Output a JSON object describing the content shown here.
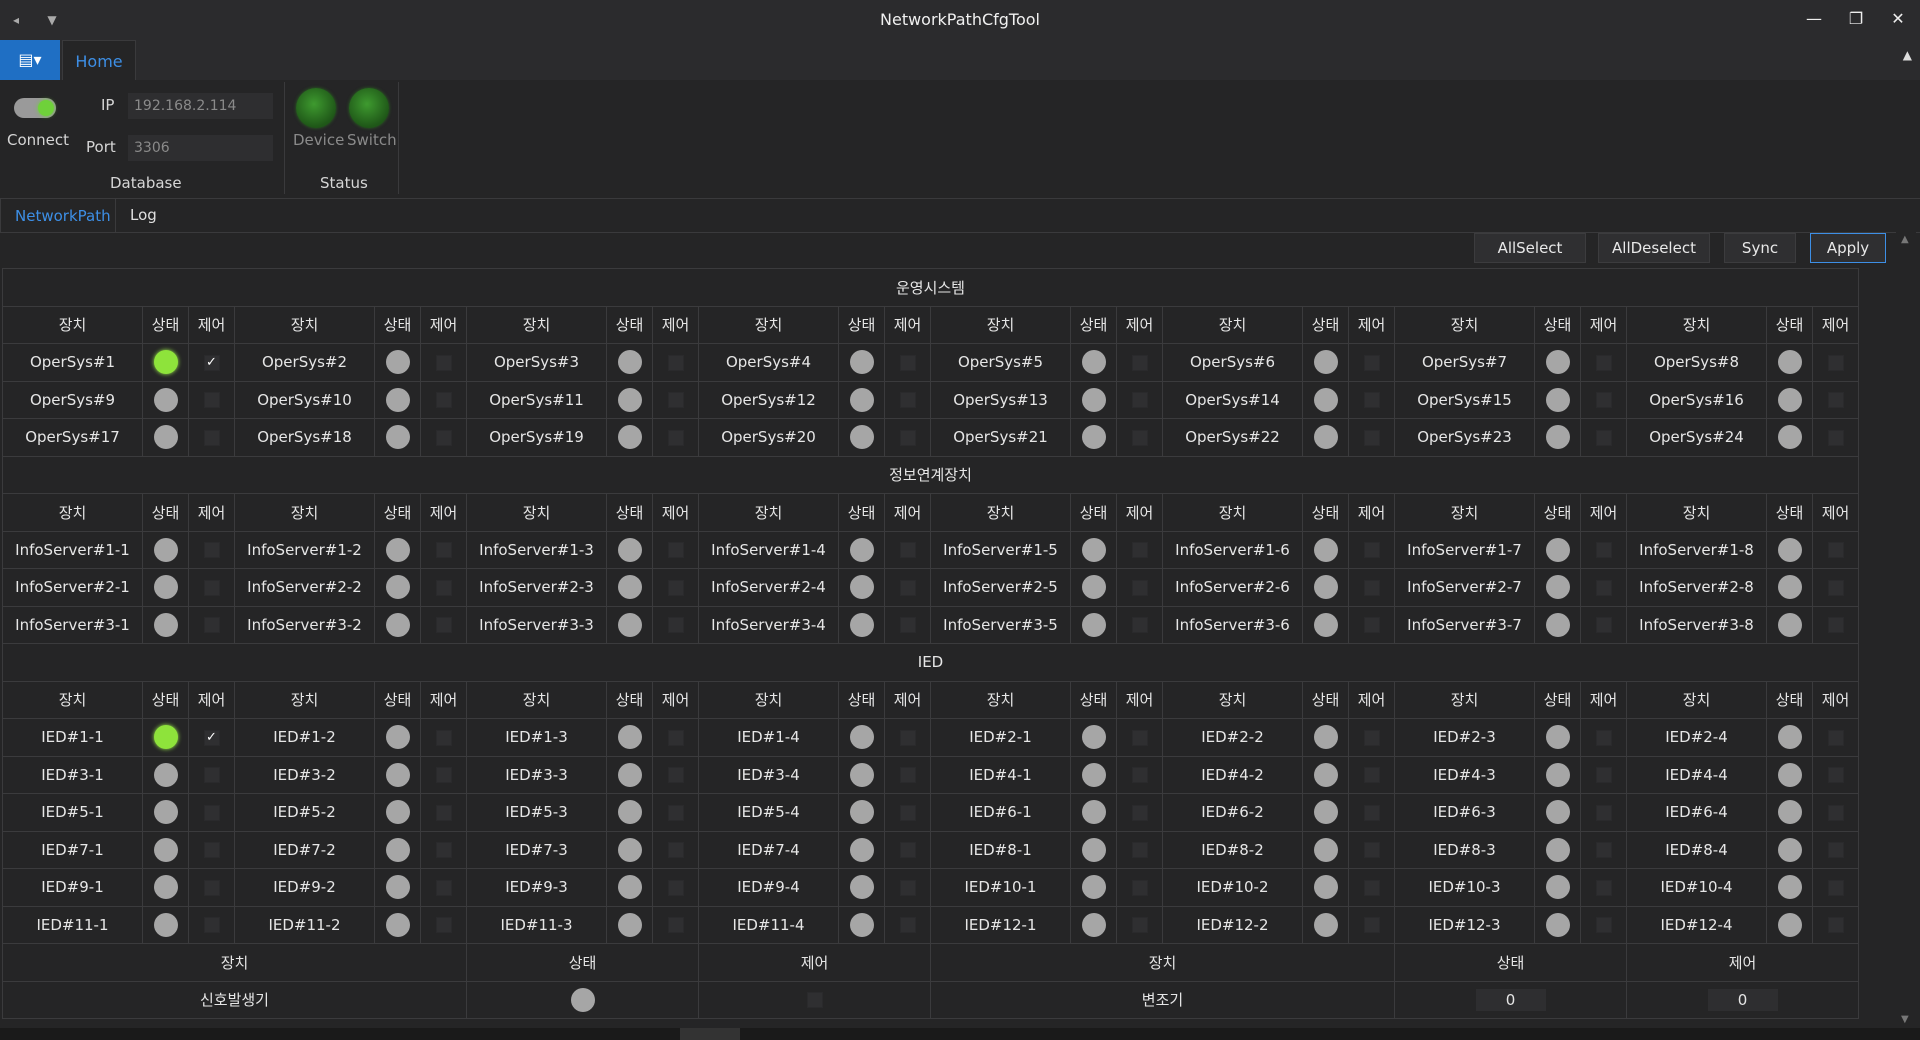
{
  "window": {
    "title": "NetworkPathCfgTool"
  },
  "ribbon": {
    "tab_home": "Home",
    "connect_label": "Connect",
    "ip_label": "IP",
    "ip_value": "192.168.2.114",
    "port_label": "Port",
    "port_value": "3306",
    "group_database": "Database",
    "device_label": "Device",
    "switch_label": "Switch",
    "group_status": "Status"
  },
  "content_tabs": [
    "NetworkPath",
    "Log"
  ],
  "toolbar": {
    "allselect": "AllSelect",
    "alldeselect": "AllDeselect",
    "sync": "Sync",
    "apply": "Apply"
  },
  "headers": {
    "device": "장치",
    "status": "상태",
    "control": "제어"
  },
  "sections": [
    {
      "title": "운영시스템",
      "rows": [
        [
          "OperSys#1",
          "OperSys#2",
          "OperSys#3",
          "OperSys#4",
          "OperSys#5",
          "OperSys#6",
          "OperSys#7",
          "OperSys#8"
        ],
        [
          "OperSys#9",
          "OperSys#10",
          "OperSys#11",
          "OperSys#12",
          "OperSys#13",
          "OperSys#14",
          "OperSys#15",
          "OperSys#16"
        ],
        [
          "OperSys#17",
          "OperSys#18",
          "OperSys#19",
          "OperSys#20",
          "OperSys#21",
          "OperSys#22",
          "OperSys#23",
          "OperSys#24"
        ]
      ],
      "active": [
        [
          0,
          0
        ]
      ]
    },
    {
      "title": "정보연계장치",
      "rows": [
        [
          "InfoServer#1-1",
          "InfoServer#1-2",
          "InfoServer#1-3",
          "InfoServer#1-4",
          "InfoServer#1-5",
          "InfoServer#1-6",
          "InfoServer#1-7",
          "InfoServer#1-8"
        ],
        [
          "InfoServer#2-1",
          "InfoServer#2-2",
          "InfoServer#2-3",
          "InfoServer#2-4",
          "InfoServer#2-5",
          "InfoServer#2-6",
          "InfoServer#2-7",
          "InfoServer#2-8"
        ],
        [
          "InfoServer#3-1",
          "InfoServer#3-2",
          "InfoServer#3-3",
          "InfoServer#3-4",
          "InfoServer#3-5",
          "InfoServer#3-6",
          "InfoServer#3-7",
          "InfoServer#3-8"
        ]
      ],
      "active": []
    },
    {
      "title": "IED",
      "rows": [
        [
          "IED#1-1",
          "IED#1-2",
          "IED#1-3",
          "IED#1-4",
          "IED#2-1",
          "IED#2-2",
          "IED#2-3",
          "IED#2-4"
        ],
        [
          "IED#3-1",
          "IED#3-2",
          "IED#3-3",
          "IED#3-4",
          "IED#4-1",
          "IED#4-2",
          "IED#4-3",
          "IED#4-4"
        ],
        [
          "IED#5-1",
          "IED#5-2",
          "IED#5-3",
          "IED#5-4",
          "IED#6-1",
          "IED#6-2",
          "IED#6-3",
          "IED#6-4"
        ],
        [
          "IED#7-1",
          "IED#7-2",
          "IED#7-3",
          "IED#7-4",
          "IED#8-1",
          "IED#8-2",
          "IED#8-3",
          "IED#8-4"
        ],
        [
          "IED#9-1",
          "IED#9-2",
          "IED#9-3",
          "IED#9-4",
          "IED#10-1",
          "IED#10-2",
          "IED#10-3",
          "IED#10-4"
        ],
        [
          "IED#11-1",
          "IED#11-2",
          "IED#11-3",
          "IED#11-4",
          "IED#12-1",
          "IED#12-2",
          "IED#12-3",
          "IED#12-4"
        ]
      ],
      "active": [
        [
          0,
          0
        ]
      ]
    }
  ],
  "footer": {
    "signal_generator": "신호발생기",
    "modulator": "변조기",
    "modulator_status_value": "0",
    "modulator_control_value": "0"
  },
  "colors": {
    "accent": "#3d8fe6",
    "status_on": "#8ee33b",
    "status_off": "#a6a6a6",
    "led": "#2f7f24"
  },
  "icons": {
    "app_menu": "app-menu-icon",
    "qa_back": "back-arrow-icon",
    "qa_dropdown": "dropdown-icon"
  }
}
